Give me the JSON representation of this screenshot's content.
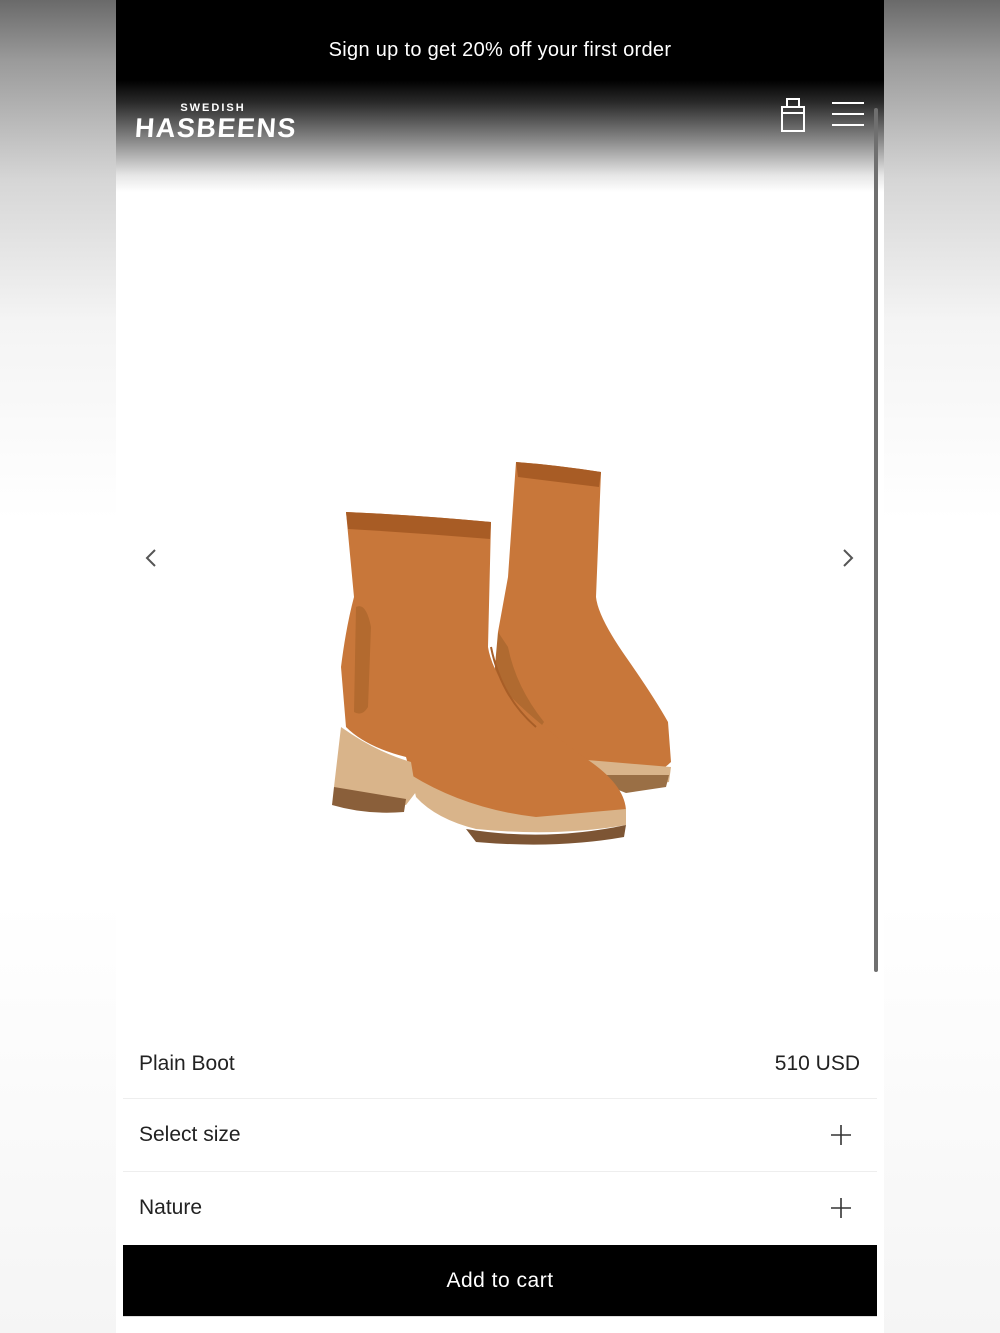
{
  "promo_banner": {
    "text": "Sign up to get 20% off your first order"
  },
  "brand": {
    "top": "SWEDISH",
    "name": "HASBEENS"
  },
  "header_icons": {
    "cart": "shopping-bag-icon",
    "menu": "hamburger-menu-icon"
  },
  "carousel": {
    "prev_icon": "chevron-left-icon",
    "next_icon": "chevron-right-icon"
  },
  "product": {
    "name": "Plain Boot",
    "price": "510 USD",
    "color": "#c8773a"
  },
  "options": [
    {
      "label": "Select size",
      "icon": "plus-icon"
    },
    {
      "label": "Nature",
      "icon": "plus-icon"
    }
  ],
  "add_to_cart": {
    "label": "Add to cart"
  }
}
